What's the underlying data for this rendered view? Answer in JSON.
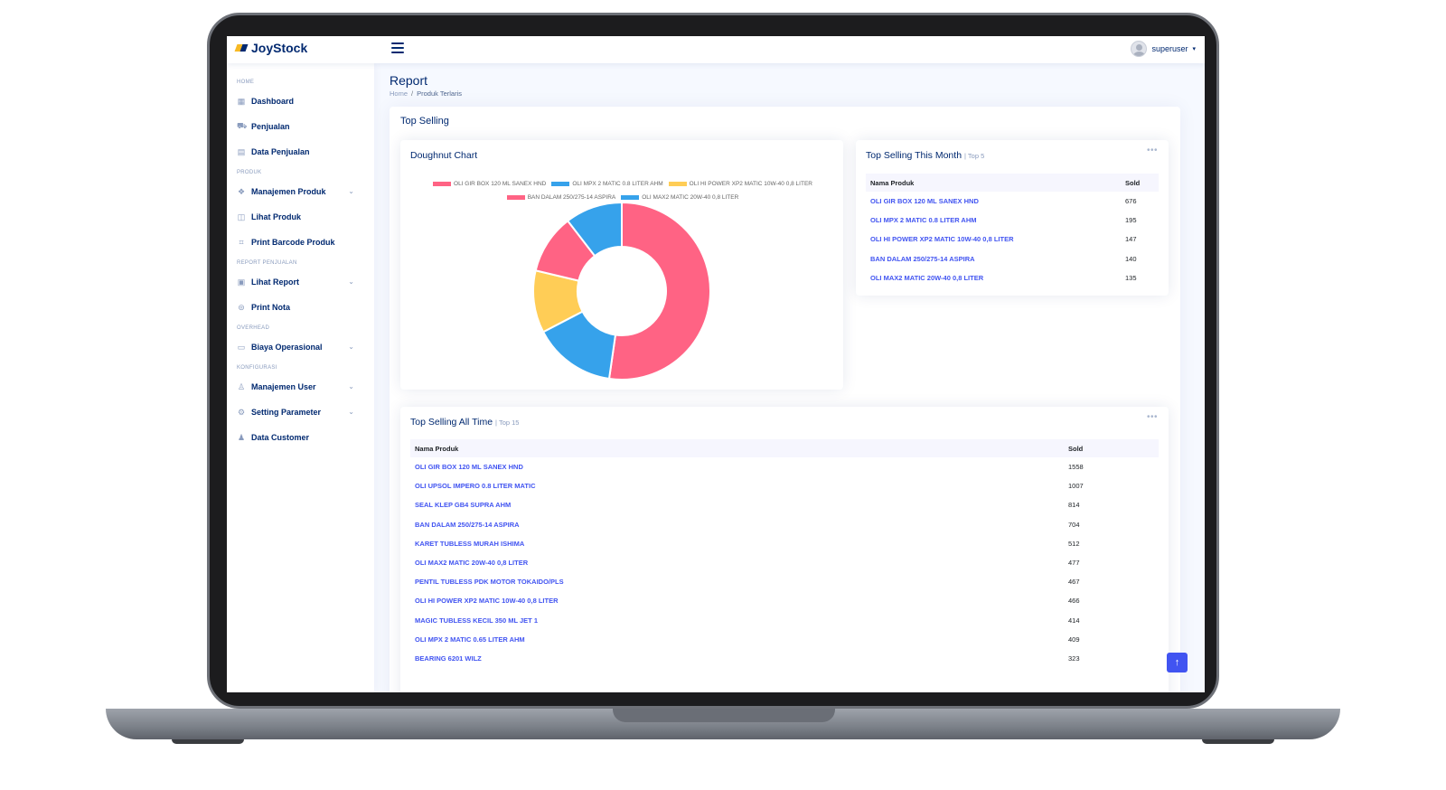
{
  "app": {
    "logo_text": "JoyStock"
  },
  "header": {
    "user_name": "superuser"
  },
  "sidebar": {
    "items": [
      {
        "kind": "heading",
        "label": "HOME"
      },
      {
        "kind": "item",
        "label": "Dashboard",
        "icon": "grid-icon",
        "glyph": "▦",
        "chevron": false
      },
      {
        "kind": "item",
        "label": "Penjualan",
        "icon": "cart-icon",
        "glyph": "⛟",
        "chevron": false
      },
      {
        "kind": "item",
        "label": "Data Penjualan",
        "icon": "table-icon",
        "glyph": "▤",
        "chevron": false
      },
      {
        "kind": "heading",
        "label": "PRODUK"
      },
      {
        "kind": "item",
        "label": "Manajemen Produk",
        "icon": "boxes-icon",
        "glyph": "❖",
        "chevron": true
      },
      {
        "kind": "item",
        "label": "Lihat Produk",
        "icon": "box-icon",
        "glyph": "◫",
        "chevron": false
      },
      {
        "kind": "item",
        "label": "Print Barcode Produk",
        "icon": "barcode-icon",
        "glyph": "⌗",
        "chevron": false
      },
      {
        "kind": "heading",
        "label": "REPORT PENJUALAN"
      },
      {
        "kind": "item",
        "label": "Lihat Report",
        "icon": "report-icon",
        "glyph": "▣",
        "chevron": true
      },
      {
        "kind": "item",
        "label": "Print Nota",
        "icon": "printer-icon",
        "glyph": "⊜",
        "chevron": false
      },
      {
        "kind": "heading",
        "label": "OVERHEAD"
      },
      {
        "kind": "item",
        "label": "Biaya Operasional",
        "icon": "wallet-icon",
        "glyph": "▭",
        "chevron": true
      },
      {
        "kind": "heading",
        "label": "KONFIGURASI"
      },
      {
        "kind": "item",
        "label": "Manajemen User",
        "icon": "user-icon",
        "glyph": "♙",
        "chevron": true
      },
      {
        "kind": "item",
        "label": "Setting Parameter",
        "icon": "gear-icon",
        "glyph": "⚙",
        "chevron": true
      },
      {
        "kind": "item",
        "label": "Data Customer",
        "icon": "people-icon",
        "glyph": "♟",
        "chevron": false
      }
    ]
  },
  "page": {
    "title": "Report",
    "breadcrumb": {
      "home": "Home",
      "current": "Produk Terlaris"
    },
    "section_title": "Top Selling"
  },
  "doughnut": {
    "title": "Doughnut Chart"
  },
  "chart_data": {
    "type": "pie",
    "title": "Doughnut Chart",
    "categories": [
      "OLI GIR BOX 120 ML SANEX HND",
      "OLI MPX 2 MATIC 0.8 LITER AHM",
      "OLI HI POWER XP2 MATIC 10W-40 0,8 LITER",
      "BAN DALAM 250/275-14 ASPIRA",
      "OLI MAX2 MATIC 20W-40 0,8 LITER"
    ],
    "values": [
      676,
      195,
      147,
      140,
      135
    ],
    "colors": [
      "#ff6384",
      "#36a2eb",
      "#ffcd56",
      "#ff6384",
      "#36a2eb"
    ],
    "legend": "top"
  },
  "month": {
    "title": "Top Selling This Month",
    "subtitle": "| Top 5",
    "col_product": "Nama Produk",
    "col_sold": "Sold",
    "rows": [
      {
        "name": "OLI GIR BOX 120 ML SANEX HND",
        "sold": "676"
      },
      {
        "name": "OLI MPX 2 MATIC 0.8 LITER AHM",
        "sold": "195"
      },
      {
        "name": "OLI HI POWER XP2 MATIC 10W-40 0,8 LITER",
        "sold": "147"
      },
      {
        "name": "BAN DALAM 250/275-14 ASPIRA",
        "sold": "140"
      },
      {
        "name": "OLI MAX2 MATIC 20W-40 0,8 LITER",
        "sold": "135"
      }
    ]
  },
  "alltime": {
    "title": "Top Selling All Time",
    "subtitle": "| Top 15",
    "col_product": "Nama Produk",
    "col_sold": "Sold",
    "rows": [
      {
        "name": "OLI GIR BOX 120 ML SANEX HND",
        "sold": "1558"
      },
      {
        "name": "OLI UPSOL IMPERO 0.8 LITER MATIC",
        "sold": "1007"
      },
      {
        "name": "SEAL KLEP GB4 SUPRA AHM",
        "sold": "814"
      },
      {
        "name": "BAN DALAM 250/275-14 ASPIRA",
        "sold": "704"
      },
      {
        "name": "KARET TUBLESS MURAH ISHIMA",
        "sold": "512"
      },
      {
        "name": "OLI MAX2 MATIC 20W-40 0,8 LITER",
        "sold": "477"
      },
      {
        "name": "PENTIL TUBLESS PDK MOTOR TOKAIDO/PLS",
        "sold": "467"
      },
      {
        "name": "OLI HI POWER XP2 MATIC 10W-40 0,8 LITER",
        "sold": "466"
      },
      {
        "name": "MAGIC TUBLESS KECIL 350 ML JET 1",
        "sold": "414"
      },
      {
        "name": "OLI MPX 2 MATIC 0.65 LITER AHM",
        "sold": "409"
      },
      {
        "name": "BEARING 6201 WILZ",
        "sold": "323"
      }
    ]
  }
}
